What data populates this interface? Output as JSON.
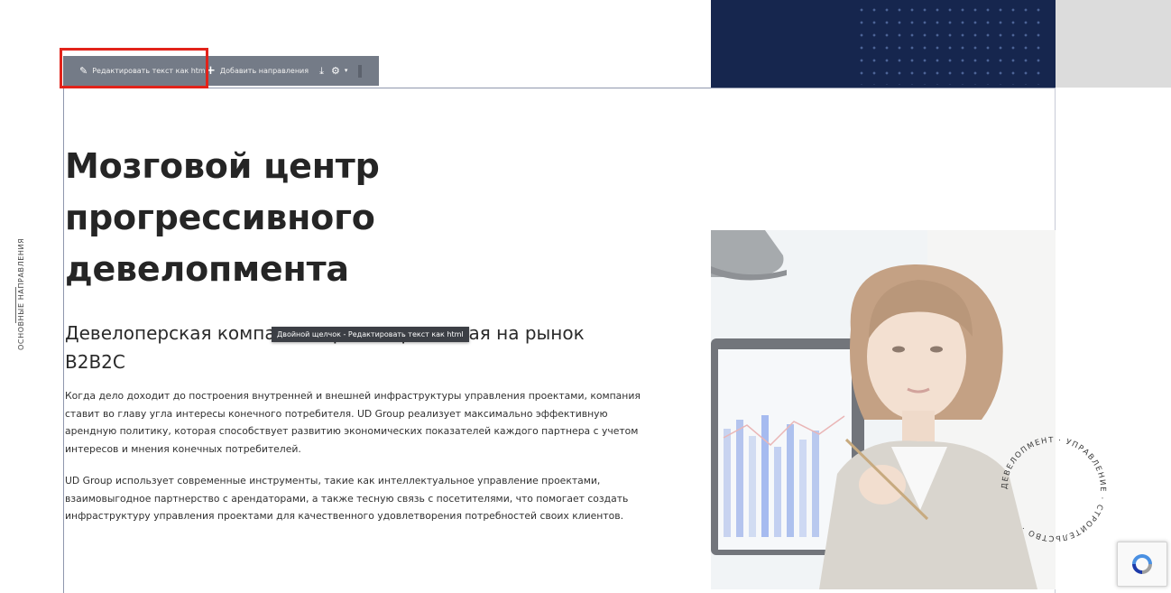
{
  "side_nav": {
    "label": "ОСНОВНЫЕ НАПРАВЛЕНИЯ"
  },
  "toolbar": {
    "edit_html_label": "Редактировать текст как html",
    "add_direction_label": "Добавить направления",
    "icons": [
      "pencil-icon",
      "plus-icon",
      "arrow-down-icon",
      "gear-icon",
      "caret-down-icon"
    ]
  },
  "hero": {
    "title_line_1": "Мозговой центр",
    "title_line_2": "прогрессивного",
    "title_line_3": "девелопмента",
    "subtitle_line_1": "Девелоперская компания, ориентированная на рынок",
    "subtitle_line_2": "B2B2C",
    "tooltip": "Двойной щелчок - Редактировать текст как html",
    "paragraph_1": "Когда дело доходит до построения внутренней и внешней инфраструктуры управления проектами, компания ставит во главу угла интересы конечного потребителя. UD Group реализует максимально эффективную арендную политику, которая способствует развитию экономических показателей каждого партнера с учетом интересов и мнения конечных потребителей.",
    "paragraph_2": "UD Group использует современные инструменты, такие как интеллектуальное управление проектами, взаимовыгодное партнерство с арендаторами, а также тесную связь с посетителями, что помогает создать инфраструктуру управления проектами для качественного удовлетворения потребностей своих клиентов."
  },
  "stamp": {
    "text": "ДЕВЕЛОПМЕНТ · УПРАВЛЕНИЕ · СТРОИТЕЛЬСТВО · "
  },
  "colors": {
    "navy": "#16264e",
    "toolbar": "#747b87",
    "highlight": "#e2231a",
    "tooltip": "#3c3f45"
  }
}
